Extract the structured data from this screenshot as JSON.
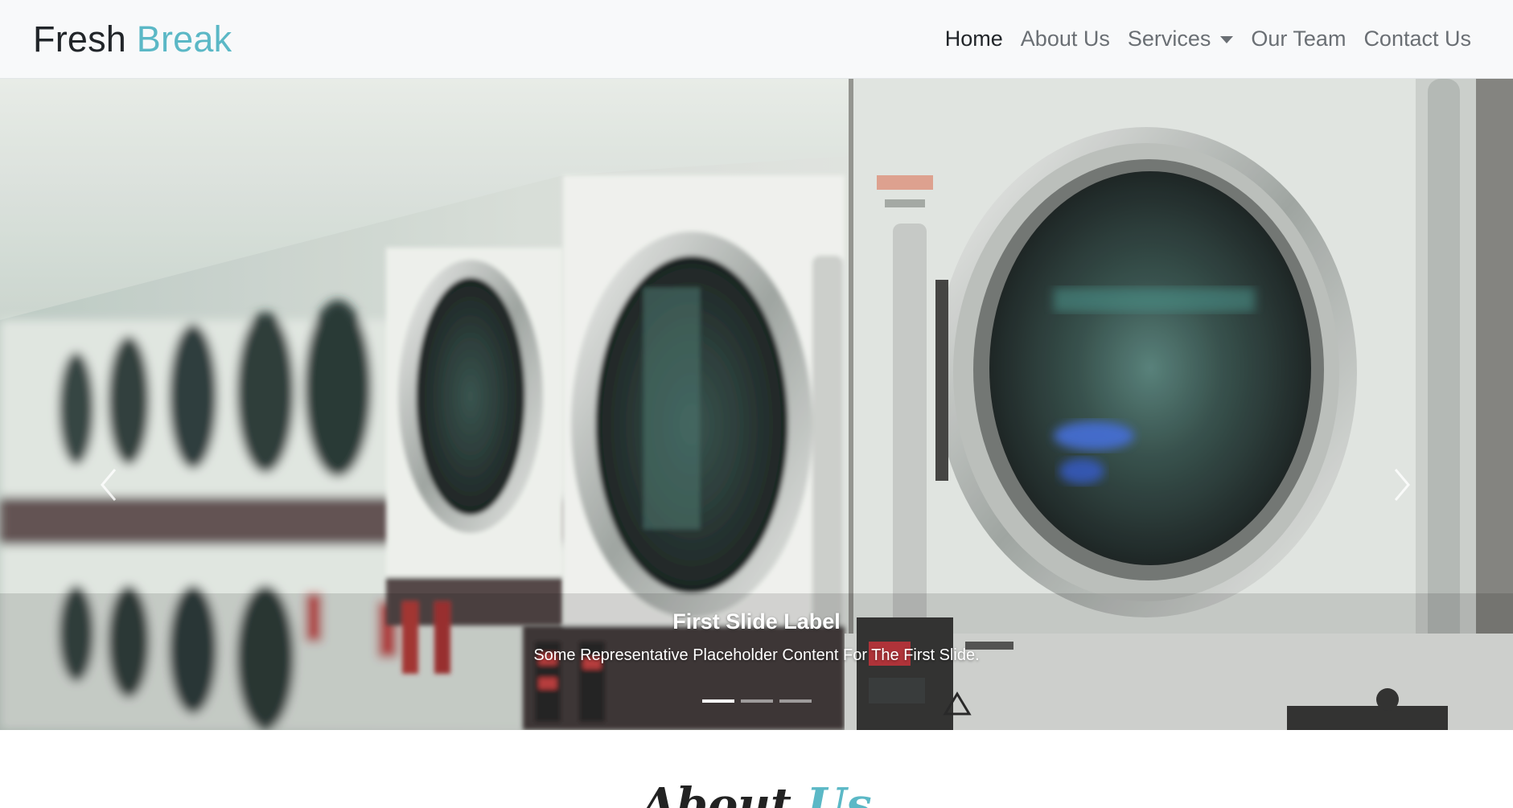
{
  "navbar": {
    "brand_primary": "Fresh",
    "brand_accent": "Break",
    "links": [
      {
        "label": "Home",
        "active": true
      },
      {
        "label": "About Us"
      },
      {
        "label": "Services",
        "dropdown": true
      },
      {
        "label": "Our Team"
      },
      {
        "label": "Contact Us"
      }
    ]
  },
  "carousel": {
    "caption_title": "First Slide Label",
    "caption_text": "Some Representative Placeholder Content For The First Slide.",
    "slide_count": 3,
    "active_slide": 1,
    "prev_icon": "chevron-left-icon",
    "next_icon": "chevron-right-icon"
  },
  "about": {
    "heading_primary": "About",
    "heading_accent": "Us"
  },
  "colors": {
    "accent": "#5bb8c6",
    "navbar_bg": "#f8f9fa",
    "text_dark": "#212529",
    "text_muted": "#6a6f74"
  }
}
